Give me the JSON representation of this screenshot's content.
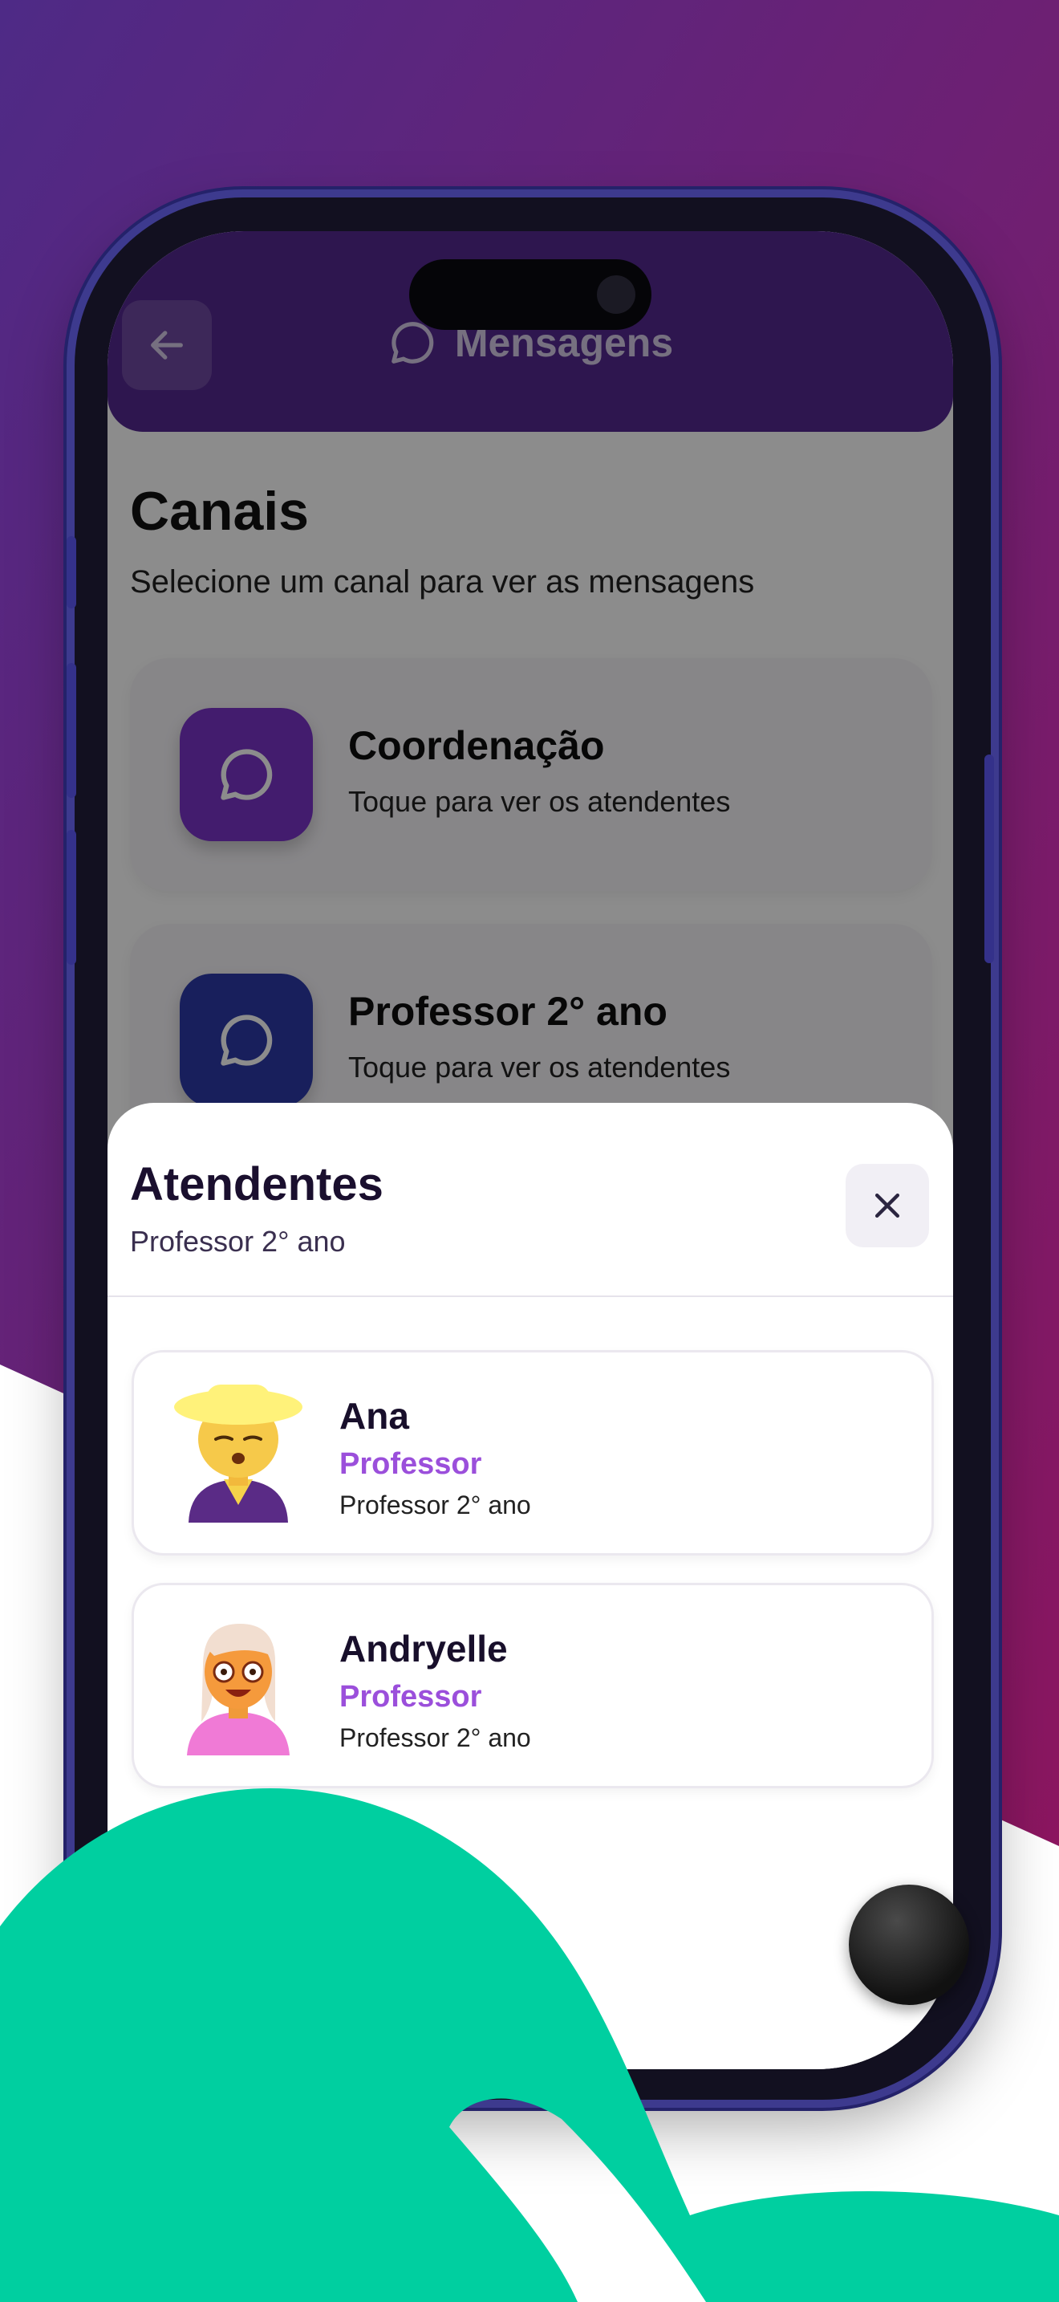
{
  "header": {
    "title": "Mensagens",
    "back_icon": "arrow-left-icon",
    "title_icon": "chat-bubble-icon"
  },
  "channels": {
    "title": "Canais",
    "subtitle": "Selecione um canal para ver as mensagens",
    "items": [
      {
        "name": "Coordenação",
        "hint": "Toque para ver os atendentes",
        "color": "#7a34c8"
      },
      {
        "name": "Professor 2° ano",
        "hint": "Toque para ver os atendentes",
        "color": "#2c3aa8"
      }
    ]
  },
  "sheet": {
    "title": "Atendentes",
    "subtitle": "Professor 2° ano",
    "attendants": [
      {
        "name": "Ana",
        "role": "Professor",
        "group": "Professor 2° ano"
      },
      {
        "name": "Andryelle",
        "role": "Professor",
        "group": "Professor 2° ano"
      }
    ]
  },
  "colors": {
    "header": "#542891",
    "accent": "#9b4fdb",
    "teal": "#00cfa0",
    "bg_top": "#4e2a86",
    "bg_bottom": "#8c1660"
  }
}
